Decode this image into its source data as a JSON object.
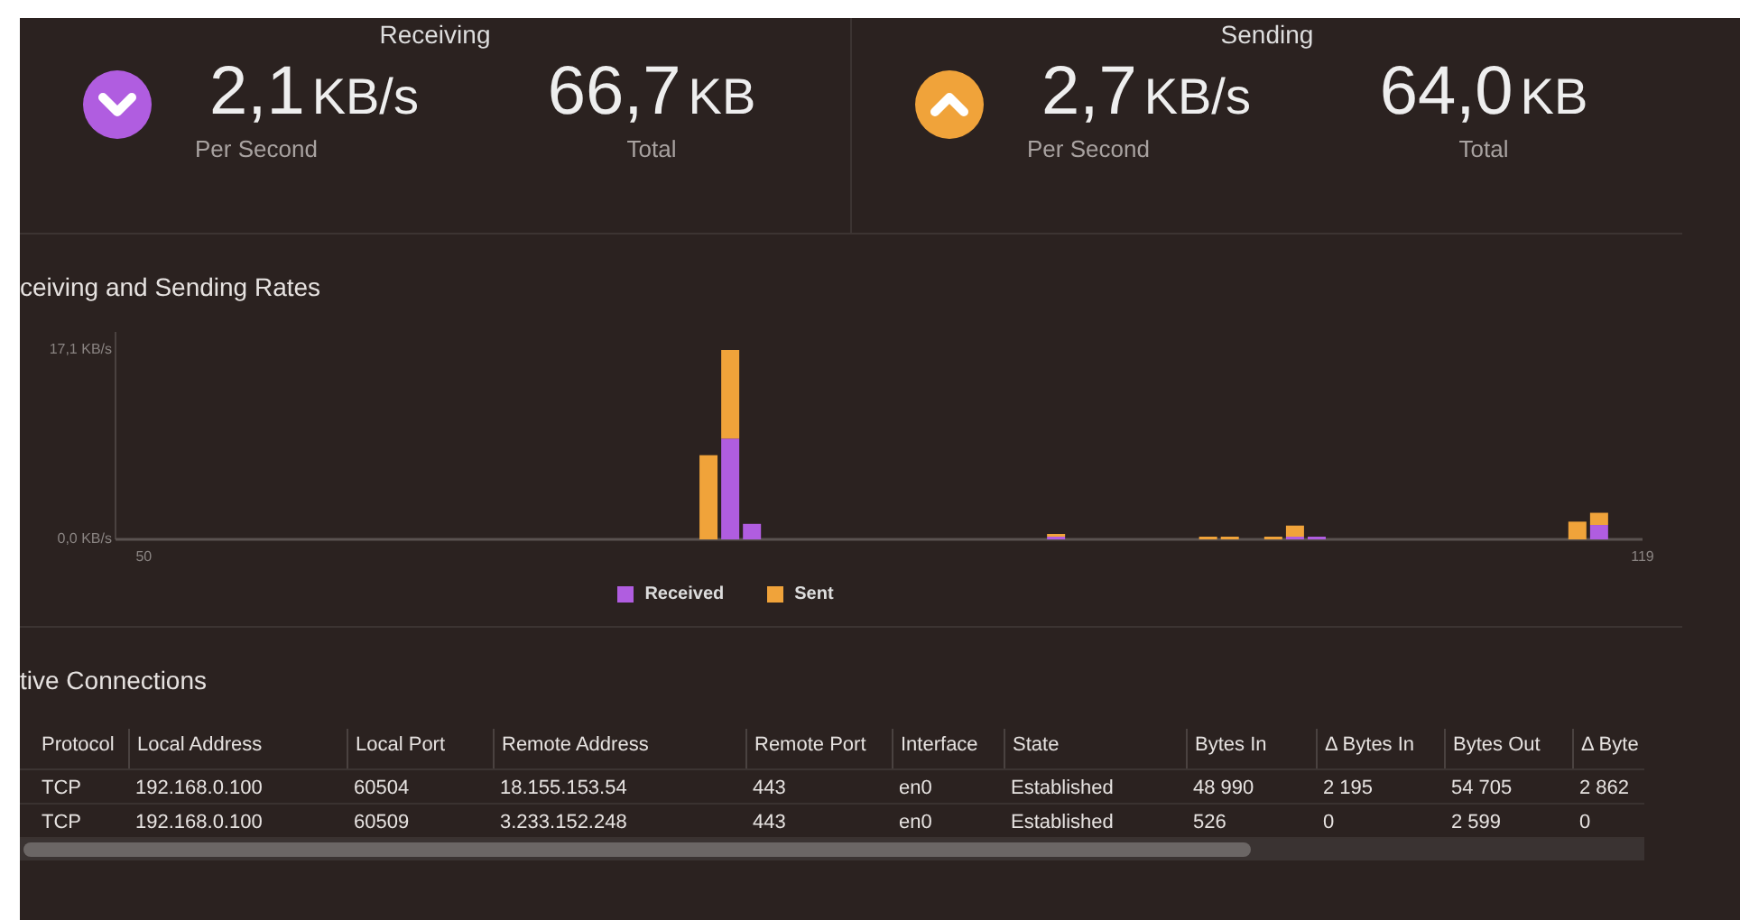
{
  "stats": [
    {
      "title": "Receiving",
      "kind": "down",
      "color": "#b05de0",
      "rate_value": "2,1",
      "rate_unit": "KB/s",
      "rate_label": "Per Second",
      "total_value": "66,7",
      "total_unit": "KB",
      "total_label": "Total"
    },
    {
      "title": "Sending",
      "kind": "up",
      "color": "#f0a33a",
      "rate_value": "2,7",
      "rate_unit": "KB/s",
      "rate_label": "Per Second",
      "total_value": "64,0",
      "total_unit": "KB",
      "total_label": "Total"
    }
  ],
  "rates": {
    "title": "ceiving and Sending Rates",
    "chart_data": {
      "type": "bar",
      "stacked": true,
      "x": [
        50,
        51,
        52,
        53,
        54,
        55,
        56,
        57,
        58,
        59,
        60,
        61,
        62,
        63,
        64,
        65,
        66,
        67,
        68,
        69,
        70,
        71,
        72,
        73,
        74,
        75,
        76,
        77,
        78,
        79,
        80,
        81,
        82,
        83,
        84,
        85,
        86,
        87,
        88,
        89,
        90,
        91,
        92,
        93,
        94,
        95,
        96,
        97,
        98,
        99,
        100,
        101,
        102,
        103,
        104,
        105,
        106,
        107,
        108,
        109,
        110,
        111,
        112,
        113,
        114,
        115,
        116,
        117,
        118,
        119
      ],
      "xlim": [
        48.7,
        119
      ],
      "xticks": [
        50,
        119
      ],
      "ylim": [
        0,
        17.1
      ],
      "yticks": [
        {
          "value": 0,
          "label": "0,0 KB/s"
        },
        {
          "value": 17.1,
          "label": "17,1 KB/s"
        }
      ],
      "series": [
        {
          "name": "Received",
          "color": "#b05de0",
          "values": [
            0,
            0,
            0,
            0,
            0,
            0,
            0,
            0,
            0,
            0,
            0,
            0,
            0,
            0,
            0,
            0,
            0,
            0,
            0,
            0,
            0,
            0,
            0,
            0,
            0,
            0,
            0,
            9.1,
            1.4,
            0,
            0,
            0,
            0,
            0,
            0,
            0,
            0,
            0,
            0,
            0,
            0,
            0,
            0.2,
            0,
            0,
            0,
            0,
            0,
            0,
            0,
            0,
            0,
            0,
            0.2,
            0.2,
            0,
            0,
            0,
            0,
            0,
            0,
            0,
            0,
            0,
            0,
            0,
            0,
            1.3,
            0,
            0
          ]
        },
        {
          "name": "Sent",
          "color": "#f0a33a",
          "values": [
            0,
            0,
            0,
            0,
            0,
            0,
            0,
            0,
            0,
            0,
            0,
            0,
            0,
            0,
            0,
            0,
            0,
            0,
            0,
            0,
            0,
            0,
            0,
            0,
            0,
            0,
            7.6,
            8.0,
            0,
            0,
            0,
            0,
            0,
            0,
            0,
            0,
            0,
            0,
            0,
            0,
            0,
            0,
            0.1,
            0,
            0,
            0,
            0,
            0,
            0,
            0.1,
            0.1,
            0,
            0.1,
            1.0,
            0,
            0,
            0,
            0,
            0,
            0,
            0,
            0,
            0,
            0,
            0,
            0,
            1.6,
            1.1,
            0,
            0
          ]
        }
      ]
    }
  },
  "connections": {
    "title": "tive Connections",
    "columns": [
      "Protocol",
      "Local Address",
      "Local Port",
      "Remote Address",
      "Remote Port",
      "Interface",
      "State",
      "Bytes In",
      "Δ Bytes In",
      "Bytes Out",
      "Δ Byte"
    ],
    "rows": [
      [
        "TCP",
        "192.168.0.100",
        "60504",
        "18.155.153.54",
        "443",
        "en0",
        "Established",
        "48 990",
        "2 195",
        "54 705",
        "2 862"
      ],
      [
        "TCP",
        "192.168.0.100",
        "60509",
        "3.233.152.248",
        "443",
        "en0",
        "Established",
        "526",
        "0",
        "2 599",
        "0"
      ]
    ]
  }
}
